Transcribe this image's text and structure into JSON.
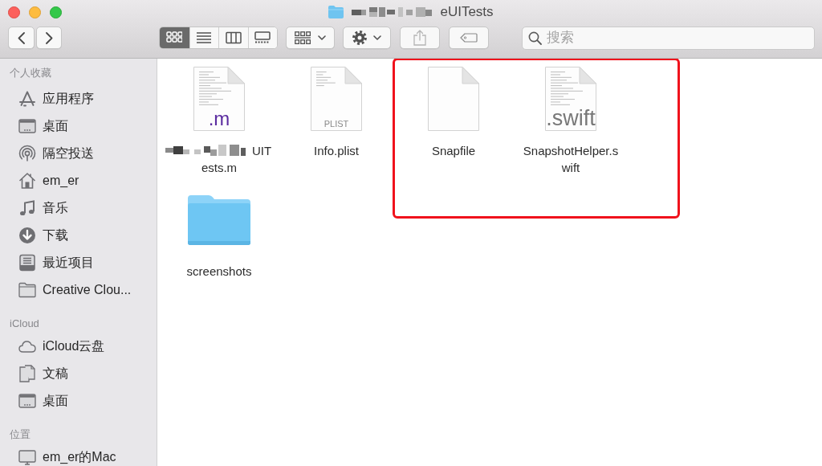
{
  "window": {
    "title": "eUITests",
    "title_redacted": true
  },
  "toolbar": {
    "view_modes": [
      {
        "kind": "icon",
        "selected": true
      },
      {
        "kind": "list",
        "selected": false
      },
      {
        "kind": "column",
        "selected": false
      },
      {
        "kind": "gallery",
        "selected": false
      }
    ],
    "buttons": [
      {
        "kind": "group",
        "disabled": false
      },
      {
        "kind": "action",
        "disabled": false
      },
      {
        "kind": "share",
        "disabled": true
      },
      {
        "kind": "tags",
        "disabled": false
      }
    ],
    "search": {
      "placeholder": "搜索"
    }
  },
  "sidebar": {
    "sections": [
      {
        "title": "个人收藏",
        "items": [
          {
            "label": "应用程序",
            "kind": "apps"
          },
          {
            "label": "桌面",
            "kind": "desktop"
          },
          {
            "label": "隔空投送",
            "kind": "airdrop"
          },
          {
            "label": "em_er",
            "kind": "home"
          },
          {
            "label": "音乐",
            "kind": "music"
          },
          {
            "label": "下载",
            "kind": "download"
          },
          {
            "label": "最近项目",
            "kind": "recents"
          },
          {
            "label": "Creative Clou...",
            "kind": "folder"
          }
        ]
      },
      {
        "title": "iCloud",
        "items": [
          {
            "label": "iCloud云盘",
            "kind": "cloud"
          },
          {
            "label": "文稿",
            "kind": "documents"
          },
          {
            "label": "桌面",
            "kind": "desktop"
          }
        ]
      },
      {
        "title": "位置",
        "items": [
          {
            "label": "em_er的Mac",
            "kind": "computer"
          }
        ]
      }
    ]
  },
  "files": [
    {
      "kind": "m-source",
      "badge": ".m",
      "name_lines": [
        "UIT",
        "ests.m"
      ],
      "redacted": true,
      "highlighted": false
    },
    {
      "kind": "plist",
      "badge": "PLIST",
      "name_lines": [
        "Info.plist"
      ],
      "redacted": false,
      "highlighted": false
    },
    {
      "kind": "blank",
      "name_lines": [
        "Snapfile"
      ],
      "redacted": false,
      "highlighted": true
    },
    {
      "kind": "swift-source",
      "badge": ".swift",
      "name_lines": [
        "SnapshotHelper.s",
        "wift"
      ],
      "redacted": false,
      "highlighted": true
    },
    {
      "kind": "folder",
      "name_lines": [
        "screenshots"
      ],
      "redacted": false,
      "highlighted": false
    }
  ]
}
